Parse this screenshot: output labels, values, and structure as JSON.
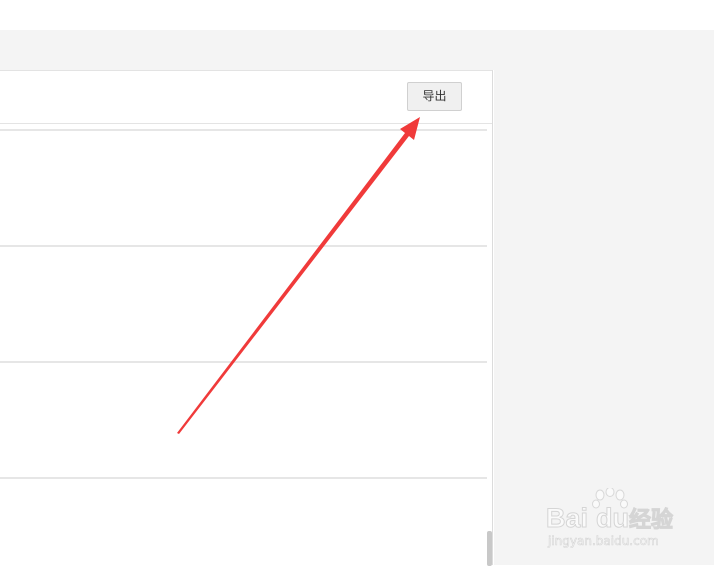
{
  "toolbar": {
    "export_label": "导出"
  },
  "watermark": {
    "brand": "Bai",
    "brand_suffix": "du",
    "brand_cn": "经验",
    "url": "jingyan.baidu.com"
  },
  "colors": {
    "arrow": "#f03a3a",
    "background": "#f4f4f4",
    "panel": "#ffffff",
    "divider": "#e6e6e6"
  },
  "icons": {
    "annotation": "arrow-pointer-icon"
  }
}
